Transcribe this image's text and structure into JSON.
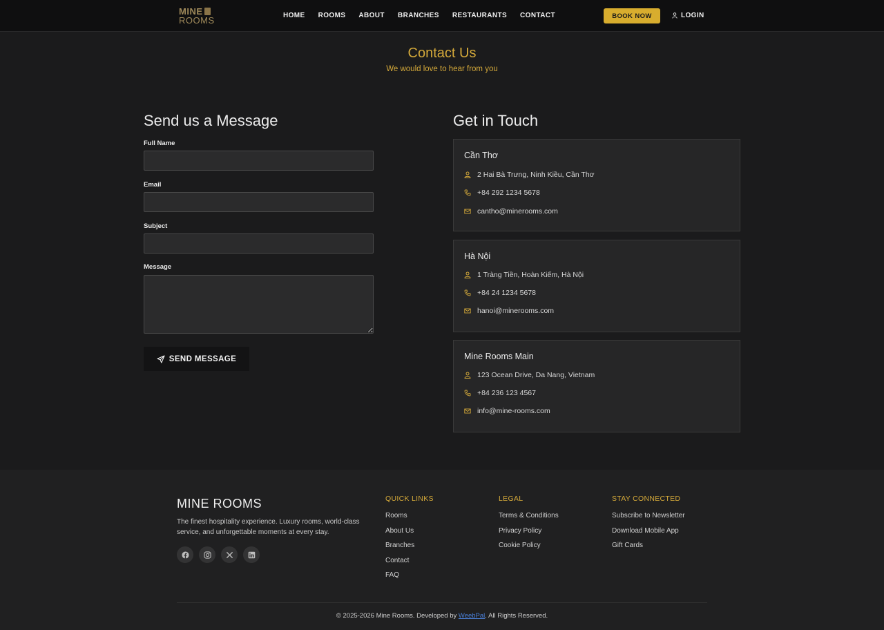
{
  "nav": {
    "logo_line1": "MINE",
    "logo_line2": "ROOMS",
    "items": [
      "HOME",
      "ROOMS",
      "ABOUT",
      "BRANCHES",
      "RESTAURANTS",
      "CONTACT"
    ],
    "book_now": "BOOK NOW",
    "login": "LOGIN"
  },
  "header": {
    "title": "Contact Us",
    "subtitle": "We would love to hear from you"
  },
  "form": {
    "heading": "Send us a Message",
    "full_name_label": "Full Name",
    "full_name_value": "",
    "email_label": "Email",
    "email_value": "",
    "subject_label": "Subject",
    "subject_value": "",
    "message_label": "Message",
    "message_value": "",
    "send_label": "SEND MESSAGE"
  },
  "touch": {
    "heading": "Get in Touch",
    "branches": [
      {
        "name": "Cần Thơ",
        "address": "2 Hai Bà Trưng, Ninh Kiều, Cần Thơ",
        "phone": "+84 292 1234 5678",
        "email": "cantho@minerooms.com"
      },
      {
        "name": "Hà Nội",
        "address": "1 Tràng Tiền, Hoàn Kiếm, Hà Nội",
        "phone": "+84 24 1234 5678",
        "email": "hanoi@minerooms.com"
      },
      {
        "name": "Mine Rooms Main",
        "address": "123 Ocean Drive, Da Nang, Vietnam",
        "phone": "+84 236 123 4567",
        "email": "info@mine-rooms.com"
      }
    ]
  },
  "footer": {
    "brand": "MINE ROOMS",
    "description": "The finest hospitality experience. Luxury rooms, world-class service, and unforgettable moments at every stay.",
    "social_icons": [
      "facebook-icon",
      "instagram-icon",
      "x-icon",
      "linkedin-icon"
    ],
    "quick_links": {
      "title": "QUICK LINKS",
      "items": [
        "Rooms",
        "About Us",
        "Branches",
        "Contact",
        "FAQ"
      ]
    },
    "legal": {
      "title": "LEGAL",
      "items": [
        "Terms & Conditions",
        "Privacy Policy",
        "Cookie Policy"
      ]
    },
    "stay_connected": {
      "title": "STAY CONNECTED",
      "items": [
        "Subscribe to Newsletter",
        "Download Mobile App",
        "Gift Cards"
      ]
    },
    "copyright_prefix": "© 2025-2026 Mine Rooms. Developed by ",
    "developer": "WeebPal",
    "copyright_suffix": ". All Rights Reserved."
  },
  "colors": {
    "accent": "#d4a93a",
    "button": "#d8ad2e",
    "background": "#1b1b1c",
    "card": "#262627"
  }
}
